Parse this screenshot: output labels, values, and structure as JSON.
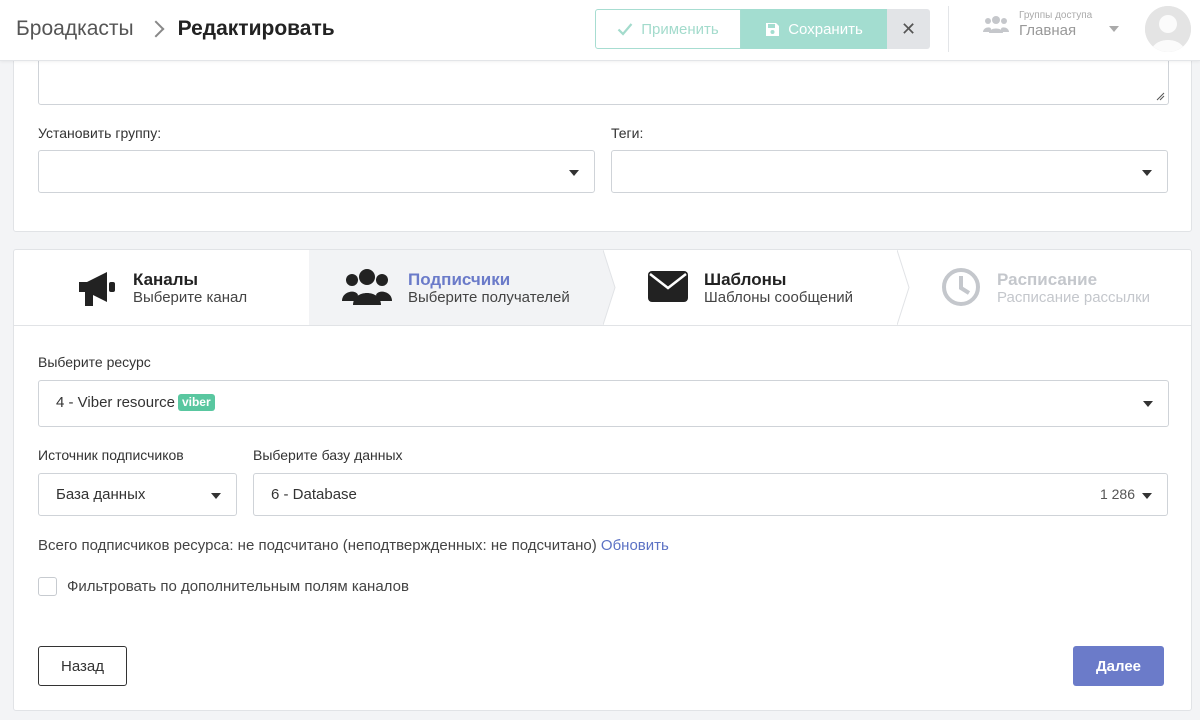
{
  "header": {
    "breadcrumb_root": "Броадкасты",
    "breadcrumb_current": "Редактировать",
    "apply_label": "Применить",
    "save_label": "Сохранить",
    "close_label": "✕",
    "access_label": "Группы доступа",
    "access_value": "Главная"
  },
  "form": {
    "group_label": "Установить группу:",
    "group_value": "",
    "tags_label": "Теги:",
    "tags_value": ""
  },
  "steps": [
    {
      "title": "Каналы",
      "subtitle": "Выберите канал",
      "icon": "megaphone-icon",
      "state": "normal"
    },
    {
      "title": "Подписчики",
      "subtitle": "Выберите получателей",
      "icon": "users-icon",
      "state": "active"
    },
    {
      "title": "Шаблоны",
      "subtitle": "Шаблоны сообщений",
      "icon": "envelope-icon",
      "state": "normal"
    },
    {
      "title": "Расписание",
      "subtitle": "Расписание рассылки",
      "icon": "clock-icon",
      "state": "disabled"
    }
  ],
  "subscribers": {
    "resource_label": "Выберите ресурс",
    "resource_value": "4 - Viber resource",
    "resource_badge": "viber",
    "source_label": "Источник подписчиков",
    "source_value": "База данных",
    "db_label": "Выберите базу данных",
    "db_value": "6 - Database",
    "db_count": "1 286",
    "info_text": "Всего подписчиков ресурса: не подсчитано (неподтвержденных: не подсчитано)",
    "refresh_link": "Обновить",
    "filter_label": "Фильтровать по дополнительным полям каналов",
    "filter_checked": false
  },
  "buttons": {
    "back": "Назад",
    "next": "Далее"
  },
  "colors": {
    "accent": "#6b7bc9",
    "success_light": "#a3ddd0",
    "viber": "#59c7a0"
  }
}
